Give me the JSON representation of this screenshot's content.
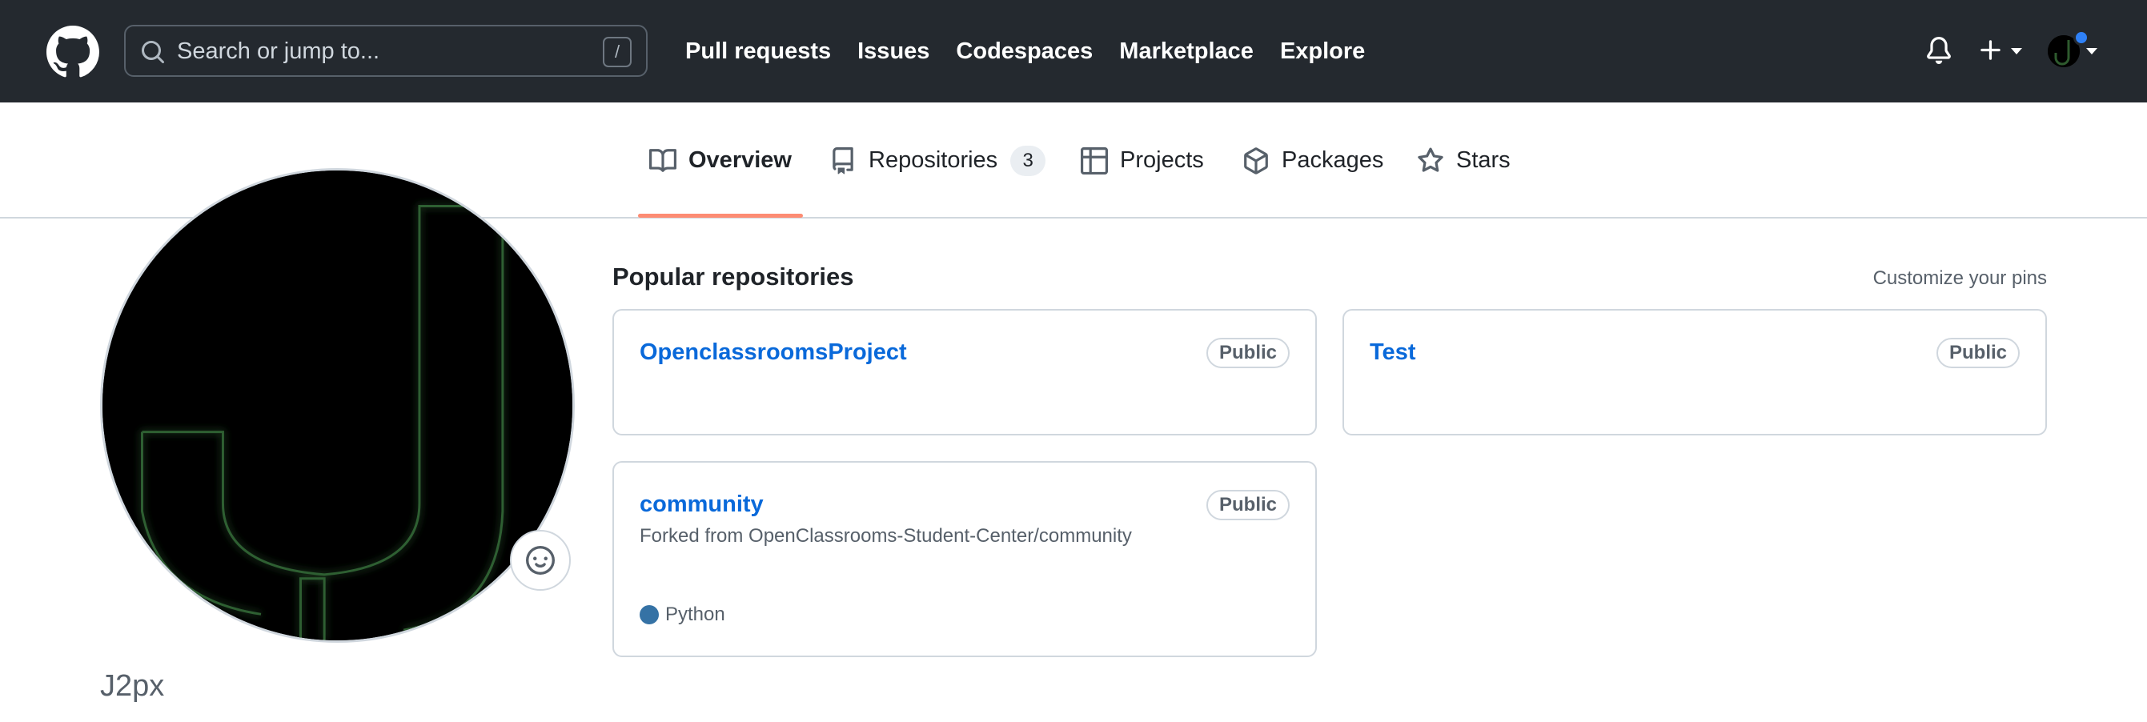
{
  "header": {
    "search_placeholder": "Search or jump to...",
    "search_shortcut": "/",
    "nav": [
      {
        "label": "Pull requests"
      },
      {
        "label": "Issues"
      },
      {
        "label": "Codespaces"
      },
      {
        "label": "Marketplace"
      },
      {
        "label": "Explore"
      }
    ],
    "icons": {
      "logo": "github-logo-icon",
      "notifications": "bell-icon",
      "create": "plus-icon",
      "avatar_caret": "chevron-down-icon"
    },
    "colors": {
      "background": "#24292f",
      "unread_dot": "#2f81f7"
    }
  },
  "tabs": [
    {
      "label": "Overview",
      "icon": "book-icon",
      "selected": true
    },
    {
      "label": "Repositories",
      "icon": "repo-icon",
      "count": "3"
    },
    {
      "label": "Projects",
      "icon": "table-icon"
    },
    {
      "label": "Packages",
      "icon": "package-icon"
    },
    {
      "label": "Stars",
      "icon": "star-icon"
    }
  ],
  "profile": {
    "username": "J2px",
    "status_icon": "smiley-icon"
  },
  "main": {
    "section_title": "Popular repositories",
    "customize_link": "Customize your pins",
    "repos": [
      {
        "name": "OpenclassroomsProject",
        "visibility": "Public"
      },
      {
        "name": "Test",
        "visibility": "Public"
      },
      {
        "name": "community",
        "visibility": "Public",
        "fork_note": "Forked from OpenClassrooms-Student-Center/community",
        "language": "Python",
        "language_color": "#3572A5"
      }
    ]
  },
  "colors": {
    "link": "#0969da",
    "selected_tab_underline": "#fd8c73",
    "muted_text": "#57606a"
  }
}
